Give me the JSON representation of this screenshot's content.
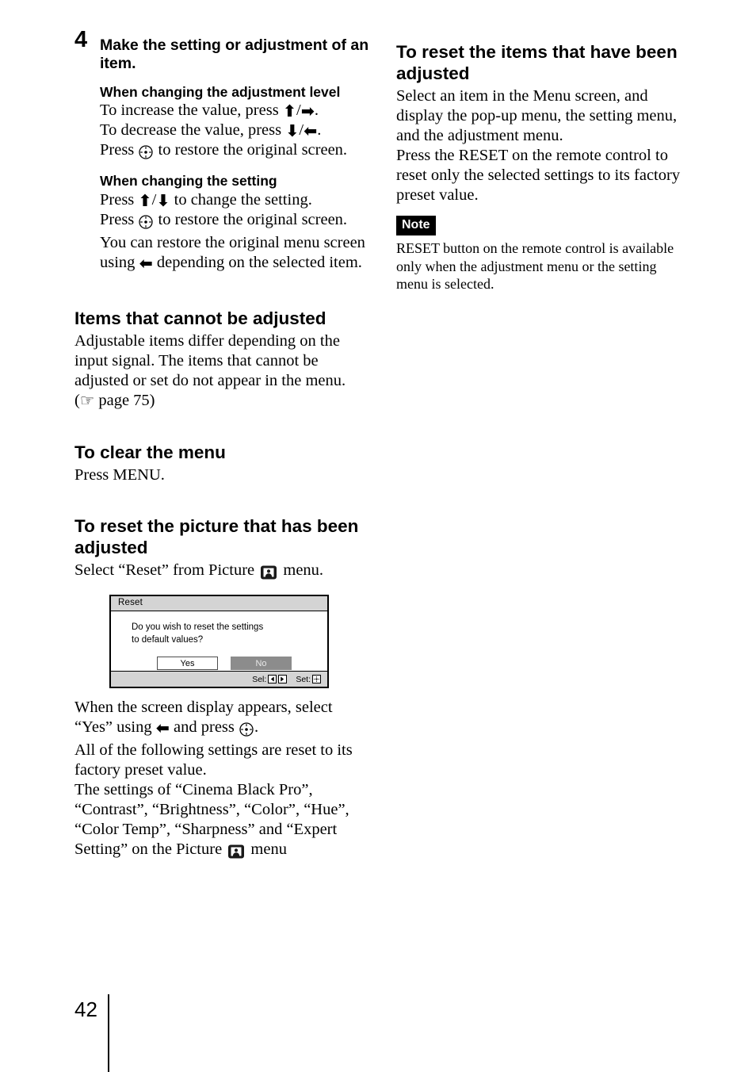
{
  "page": {
    "number": "42"
  },
  "left_column": {
    "step": {
      "number": "4",
      "title": "Make the setting or adjustment of an item."
    },
    "adjustment_level": {
      "heading": "When changing the adjustment level",
      "line_increase_pre": "To increase the value, press ",
      "line_increase_post": ".",
      "line_decrease_pre": "To decrease the value, press ",
      "line_decrease_post": ".",
      "line_press_pre": "Press ",
      "line_press_post": " to restore the original screen."
    },
    "changing_setting": {
      "heading": "When changing the setting",
      "line1_pre": "Press ",
      "line1_post": " to change the setting.",
      "line2_pre": "Press ",
      "line2_post": " to restore the original screen.",
      "line3_pre": "You can restore the original menu screen using ",
      "line3_post": " depending on the selected item."
    },
    "cannot_adjust": {
      "heading": "Items that cannot be adjusted",
      "body": "Adjustable items differ depending on the input signal. The items that cannot be adjusted or set do not appear in the menu.",
      "reference": "page 75"
    },
    "clear_menu": {
      "heading": "To clear the menu",
      "body": "Press MENU."
    },
    "reset_picture": {
      "heading": "To reset the picture that has been adjusted",
      "select_pre": "Select “Reset” from Picture ",
      "select_post": " menu.",
      "after_pre": "When the screen display appears, select “Yes” using ",
      "after_mid": " and press ",
      "after_post": ".",
      "all_reset": "All of the following settings are reset to its factory preset value.",
      "settings_pre": "The settings of “Cinema Black Pro”, “Contrast”, “Brightness”, “Color”, “Hue”, “Color Temp”, “Sharpness” and “Expert Setting” on the Picture ",
      "settings_post": " menu"
    },
    "osd_dialog": {
      "title": "Reset",
      "message_line1": "Do you wish to reset the settings",
      "message_line2": "to default values?",
      "button_yes": "Yes",
      "button_no": "No",
      "hint_sel_label": "Sel:",
      "hint_set_label": "Set:"
    }
  },
  "right_column": {
    "reset_items": {
      "heading": "To reset the items that have been adjusted",
      "body1": "Select an item in the Menu screen, and display the pop-up menu, the setting menu, and the adjustment menu.",
      "body2": "Press the RESET on the remote control to reset only the selected settings to its factory preset value."
    },
    "note": {
      "tag": "Note",
      "body": "RESET button on the remote control is available only when the adjustment menu or the setting menu is selected."
    }
  },
  "colors": {
    "text": "#000000",
    "page_background": "#ffffff",
    "osd_titlebar": "#d4d4d4",
    "osd_selected_button": "#8c8c8c",
    "note_tag_background": "#000000"
  }
}
